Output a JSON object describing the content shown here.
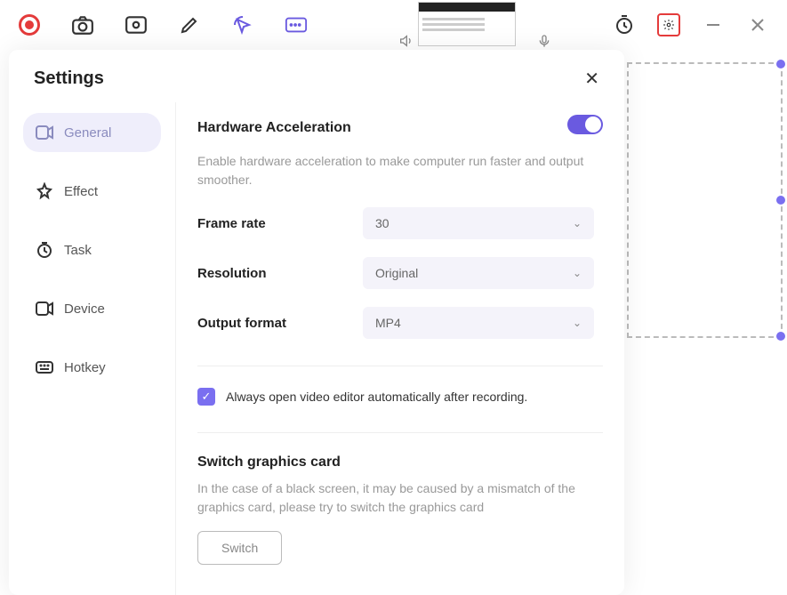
{
  "toolbar": {
    "icons": [
      "record",
      "camera",
      "webcam",
      "pencil",
      "cursor",
      "text-box"
    ],
    "right_icons": [
      "timer",
      "settings",
      "minimize",
      "close"
    ]
  },
  "settings": {
    "title": "Settings",
    "sidebar": [
      {
        "key": "general",
        "label": "General"
      },
      {
        "key": "effect",
        "label": "Effect"
      },
      {
        "key": "task",
        "label": "Task"
      },
      {
        "key": "device",
        "label": "Device"
      },
      {
        "key": "hotkey",
        "label": "Hotkey"
      }
    ],
    "hardware": {
      "title": "Hardware Acceleration",
      "desc": "Enable hardware acceleration to make computer run faster and output smoother.",
      "enabled": true
    },
    "fields": {
      "frame_rate": {
        "label": "Frame rate",
        "value": "30"
      },
      "resolution": {
        "label": "Resolution",
        "value": "Original"
      },
      "output_format": {
        "label": "Output format",
        "value": "MP4"
      }
    },
    "auto_editor": {
      "label": "Always open video editor automatically after recording.",
      "checked": true
    },
    "switch_graphics": {
      "title": "Switch graphics card",
      "desc": "In the case of a black screen, it may be caused by a mismatch of the graphics card, please try to switch the graphics card",
      "button": "Switch"
    }
  }
}
